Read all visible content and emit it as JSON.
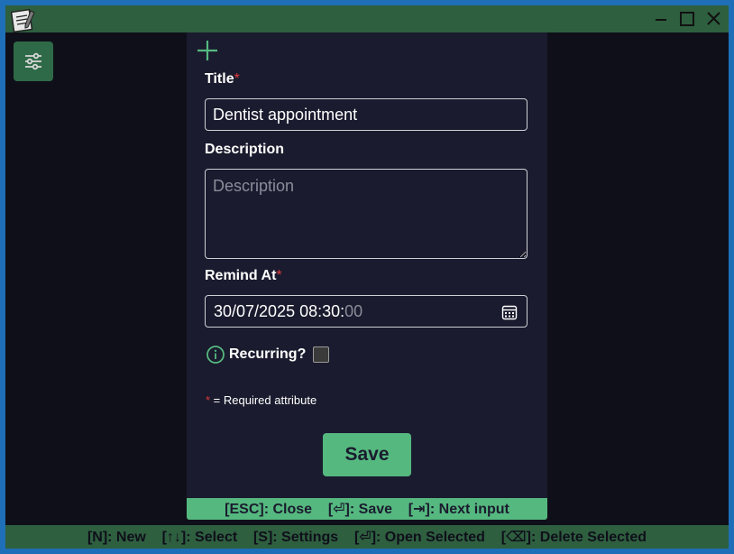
{
  "dialog": {
    "title_label": "Title",
    "title_value": "Dentist appointment",
    "description_label": "Description",
    "description_placeholder": "Description",
    "remind_label": "Remind At",
    "remind_value": "30/07/2025 08:30:",
    "remind_seconds": "00",
    "recurring_label": "Recurring?",
    "recurring_checked": false,
    "required_marker": "*",
    "required_note": " = Required attribute",
    "save_label": "Save",
    "hint_bar": "[ESC]: Close    [⏎]: Save    [⇥]: Next input"
  },
  "status_bar": "[N]: New    [↑↓]: Select    [S]: Settings    [⏎]: Open Selected    [⌫]: Delete Selected",
  "icons": {
    "app": "notepad-icon",
    "settings": "sliders-icon",
    "add": "plus-icon",
    "calendar": "calendar-icon",
    "info": "info-icon"
  },
  "colors": {
    "accent": "#55b87f",
    "titlebar": "#2e5f3f",
    "background": "#0f0f1a",
    "dialog": "#1a1b2e",
    "required": "#e03b3b"
  }
}
